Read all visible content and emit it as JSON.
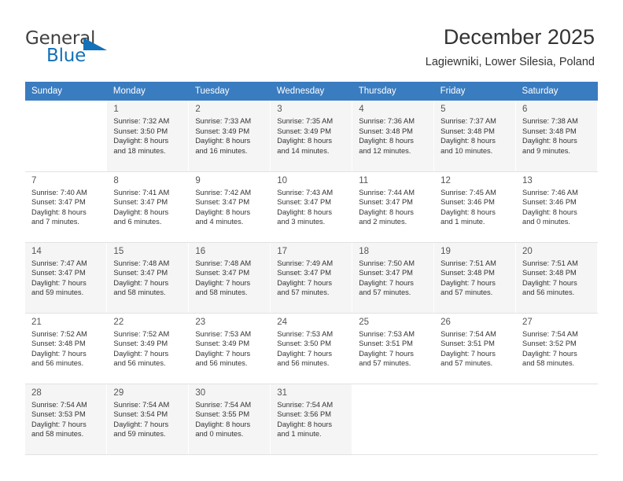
{
  "brand": {
    "name_part1": "General",
    "name_part2": "Blue"
  },
  "header": {
    "title": "December 2025",
    "location": "Lagiewniki, Lower Silesia, Poland"
  },
  "calendar": {
    "weekday_headers": [
      "Sunday",
      "Monday",
      "Tuesday",
      "Wednesday",
      "Thursday",
      "Friday",
      "Saturday"
    ],
    "accent_color": "#3a7cc0",
    "alt_row_color": "#f5f5f5",
    "weeks": [
      [
        {
          "day": "",
          "lines": []
        },
        {
          "day": "1",
          "lines": [
            "Sunrise: 7:32 AM",
            "Sunset: 3:50 PM",
            "Daylight: 8 hours",
            "and 18 minutes."
          ]
        },
        {
          "day": "2",
          "lines": [
            "Sunrise: 7:33 AM",
            "Sunset: 3:49 PM",
            "Daylight: 8 hours",
            "and 16 minutes."
          ]
        },
        {
          "day": "3",
          "lines": [
            "Sunrise: 7:35 AM",
            "Sunset: 3:49 PM",
            "Daylight: 8 hours",
            "and 14 minutes."
          ]
        },
        {
          "day": "4",
          "lines": [
            "Sunrise: 7:36 AM",
            "Sunset: 3:48 PM",
            "Daylight: 8 hours",
            "and 12 minutes."
          ]
        },
        {
          "day": "5",
          "lines": [
            "Sunrise: 7:37 AM",
            "Sunset: 3:48 PM",
            "Daylight: 8 hours",
            "and 10 minutes."
          ]
        },
        {
          "day": "6",
          "lines": [
            "Sunrise: 7:38 AM",
            "Sunset: 3:48 PM",
            "Daylight: 8 hours",
            "and 9 minutes."
          ]
        }
      ],
      [
        {
          "day": "7",
          "lines": [
            "Sunrise: 7:40 AM",
            "Sunset: 3:47 PM",
            "Daylight: 8 hours",
            "and 7 minutes."
          ]
        },
        {
          "day": "8",
          "lines": [
            "Sunrise: 7:41 AM",
            "Sunset: 3:47 PM",
            "Daylight: 8 hours",
            "and 6 minutes."
          ]
        },
        {
          "day": "9",
          "lines": [
            "Sunrise: 7:42 AM",
            "Sunset: 3:47 PM",
            "Daylight: 8 hours",
            "and 4 minutes."
          ]
        },
        {
          "day": "10",
          "lines": [
            "Sunrise: 7:43 AM",
            "Sunset: 3:47 PM",
            "Daylight: 8 hours",
            "and 3 minutes."
          ]
        },
        {
          "day": "11",
          "lines": [
            "Sunrise: 7:44 AM",
            "Sunset: 3:47 PM",
            "Daylight: 8 hours",
            "and 2 minutes."
          ]
        },
        {
          "day": "12",
          "lines": [
            "Sunrise: 7:45 AM",
            "Sunset: 3:46 PM",
            "Daylight: 8 hours",
            "and 1 minute."
          ]
        },
        {
          "day": "13",
          "lines": [
            "Sunrise: 7:46 AM",
            "Sunset: 3:46 PM",
            "Daylight: 8 hours",
            "and 0 minutes."
          ]
        }
      ],
      [
        {
          "day": "14",
          "lines": [
            "Sunrise: 7:47 AM",
            "Sunset: 3:47 PM",
            "Daylight: 7 hours",
            "and 59 minutes."
          ]
        },
        {
          "day": "15",
          "lines": [
            "Sunrise: 7:48 AM",
            "Sunset: 3:47 PM",
            "Daylight: 7 hours",
            "and 58 minutes."
          ]
        },
        {
          "day": "16",
          "lines": [
            "Sunrise: 7:48 AM",
            "Sunset: 3:47 PM",
            "Daylight: 7 hours",
            "and 58 minutes."
          ]
        },
        {
          "day": "17",
          "lines": [
            "Sunrise: 7:49 AM",
            "Sunset: 3:47 PM",
            "Daylight: 7 hours",
            "and 57 minutes."
          ]
        },
        {
          "day": "18",
          "lines": [
            "Sunrise: 7:50 AM",
            "Sunset: 3:47 PM",
            "Daylight: 7 hours",
            "and 57 minutes."
          ]
        },
        {
          "day": "19",
          "lines": [
            "Sunrise: 7:51 AM",
            "Sunset: 3:48 PM",
            "Daylight: 7 hours",
            "and 57 minutes."
          ]
        },
        {
          "day": "20",
          "lines": [
            "Sunrise: 7:51 AM",
            "Sunset: 3:48 PM",
            "Daylight: 7 hours",
            "and 56 minutes."
          ]
        }
      ],
      [
        {
          "day": "21",
          "lines": [
            "Sunrise: 7:52 AM",
            "Sunset: 3:48 PM",
            "Daylight: 7 hours",
            "and 56 minutes."
          ]
        },
        {
          "day": "22",
          "lines": [
            "Sunrise: 7:52 AM",
            "Sunset: 3:49 PM",
            "Daylight: 7 hours",
            "and 56 minutes."
          ]
        },
        {
          "day": "23",
          "lines": [
            "Sunrise: 7:53 AM",
            "Sunset: 3:49 PM",
            "Daylight: 7 hours",
            "and 56 minutes."
          ]
        },
        {
          "day": "24",
          "lines": [
            "Sunrise: 7:53 AM",
            "Sunset: 3:50 PM",
            "Daylight: 7 hours",
            "and 56 minutes."
          ]
        },
        {
          "day": "25",
          "lines": [
            "Sunrise: 7:53 AM",
            "Sunset: 3:51 PM",
            "Daylight: 7 hours",
            "and 57 minutes."
          ]
        },
        {
          "day": "26",
          "lines": [
            "Sunrise: 7:54 AM",
            "Sunset: 3:51 PM",
            "Daylight: 7 hours",
            "and 57 minutes."
          ]
        },
        {
          "day": "27",
          "lines": [
            "Sunrise: 7:54 AM",
            "Sunset: 3:52 PM",
            "Daylight: 7 hours",
            "and 58 minutes."
          ]
        }
      ],
      [
        {
          "day": "28",
          "lines": [
            "Sunrise: 7:54 AM",
            "Sunset: 3:53 PM",
            "Daylight: 7 hours",
            "and 58 minutes."
          ]
        },
        {
          "day": "29",
          "lines": [
            "Sunrise: 7:54 AM",
            "Sunset: 3:54 PM",
            "Daylight: 7 hours",
            "and 59 minutes."
          ]
        },
        {
          "day": "30",
          "lines": [
            "Sunrise: 7:54 AM",
            "Sunset: 3:55 PM",
            "Daylight: 8 hours",
            "and 0 minutes."
          ]
        },
        {
          "day": "31",
          "lines": [
            "Sunrise: 7:54 AM",
            "Sunset: 3:56 PM",
            "Daylight: 8 hours",
            "and 1 minute."
          ]
        },
        {
          "day": "",
          "lines": []
        },
        {
          "day": "",
          "lines": []
        },
        {
          "day": "",
          "lines": []
        }
      ]
    ]
  }
}
